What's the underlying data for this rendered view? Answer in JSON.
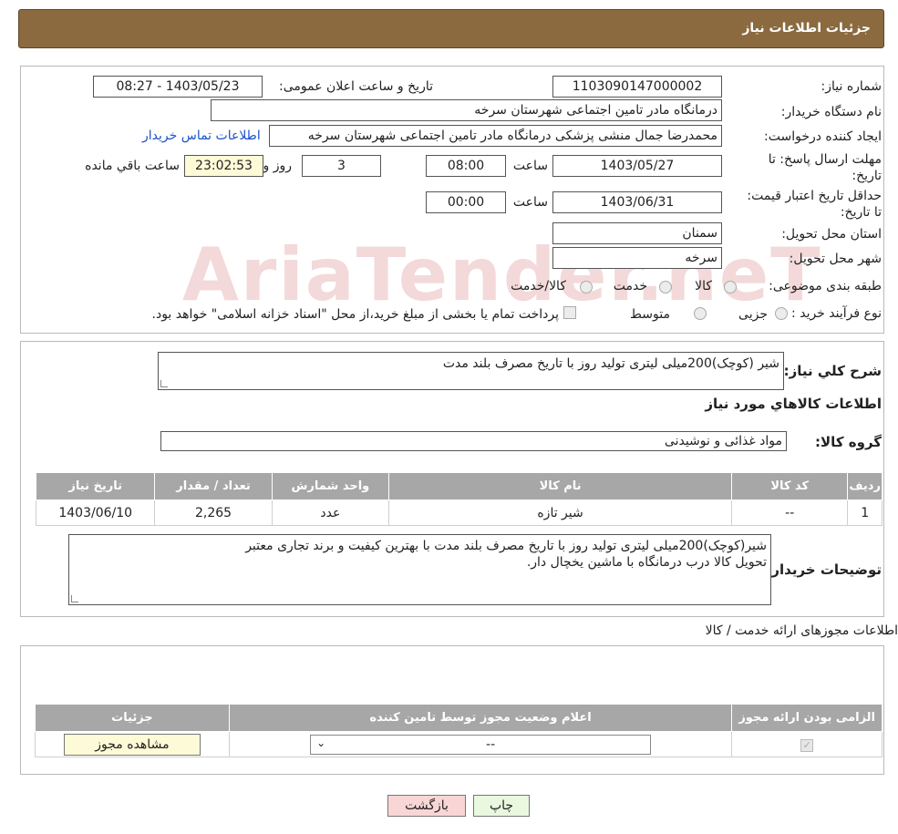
{
  "header": {
    "title": "جزئیات اطلاعات نیاز"
  },
  "watermark": "AriaTender.neT",
  "form": {
    "need_number_label": "شماره نیاز:",
    "need_number": "1103090147000002",
    "announce_label": "تاریخ و ساعت اعلان عمومی:",
    "announce_value": "1403/05/23 - 08:27",
    "buyer_org_label": "نام دستگاه خریدار:",
    "buyer_org": "درمانگاه مادر تامین اجتماعی شهرستان سرخه",
    "requester_label": "ایجاد کننده درخواست:",
    "requester": "محمدرضا جمال منشی پزشکی درمانگاه مادر تامین اجتماعی شهرستان سرخه",
    "contact_link": "اطلاعات تماس خریدار",
    "deadline_label": "مهلت ارسال پاسخ: تا تاریخ:",
    "deadline_date": "1403/05/27",
    "time_label": "ساعت",
    "deadline_time": "08:00",
    "days_value": "3",
    "days_label": "روز و",
    "remaining_time": "23:02:53",
    "remaining_label": "ساعت باقي مانده",
    "validity_label": "حداقل تاریخ اعتبار قیمت: تا تاریخ:",
    "validity_date": "1403/06/31",
    "validity_time": "00:00",
    "province_label": "استان محل تحویل:",
    "province": "سمنان",
    "city_label": "شهر محل تحویل:",
    "city": "سرخه",
    "category_label": "طبقه بندی موضوعی:",
    "category_options": [
      "کالا",
      "خدمت",
      "کالا/خدمت"
    ],
    "purchase_type_label": "نوع فرآیند خرید :",
    "purchase_type_options": [
      "جزیی",
      "متوسط"
    ],
    "purchase_note": "پرداخت تمام یا بخشی از مبلغ خرید،از محل \"اسناد خزانه اسلامی\" خواهد بود."
  },
  "summary": {
    "label": "شرح کلي نياز:",
    "text": "شیر (کوچک)200میلی لیتری تولید روز با تاریخ مصرف بلند مدت",
    "goods_title": "اطلاعات کالاهاي مورد نياز",
    "group_label": "گروه کالا:",
    "group_value": "مواد غذائی و نوشیدنی"
  },
  "items_table": {
    "headers": [
      "رديف",
      "کد کالا",
      "نام کالا",
      "واحد شمارش",
      "تعداد / مقدار",
      "تاريخ نياز"
    ],
    "rows": [
      [
        "1",
        "--",
        "شیر تازه",
        "عدد",
        "2,265",
        "1403/06/10"
      ]
    ]
  },
  "buyer_notes": {
    "label": "توضيحات خريدار:",
    "line1": "شیر(کوچک)200میلی لیتری تولید روز با تاریخ مصرف بلند مدت با بهترین کیفیت و برند تجاری معتبر",
    "line2": "تحویل کالا درب درمانگاه با ماشین یخچال دار."
  },
  "permits": {
    "title": "اطلاعات مجوزهای ارائه خدمت / کالا",
    "headers": [
      "الزامی بودن ارائه مجوز",
      "اعلام وضعیت مجوز توسط تامین کننده",
      "جزئیات"
    ],
    "select_value": "--",
    "view_button": "مشاهده مجوز"
  },
  "buttons": {
    "print": "چاپ",
    "back": "بازگشت"
  },
  "colors": {
    "header_bg": "#8b6a3f",
    "table_header": "#a7a7a7",
    "link": "#1a52c8",
    "back_btn": "#f9d6d6",
    "print_btn": "#e9f8df"
  }
}
